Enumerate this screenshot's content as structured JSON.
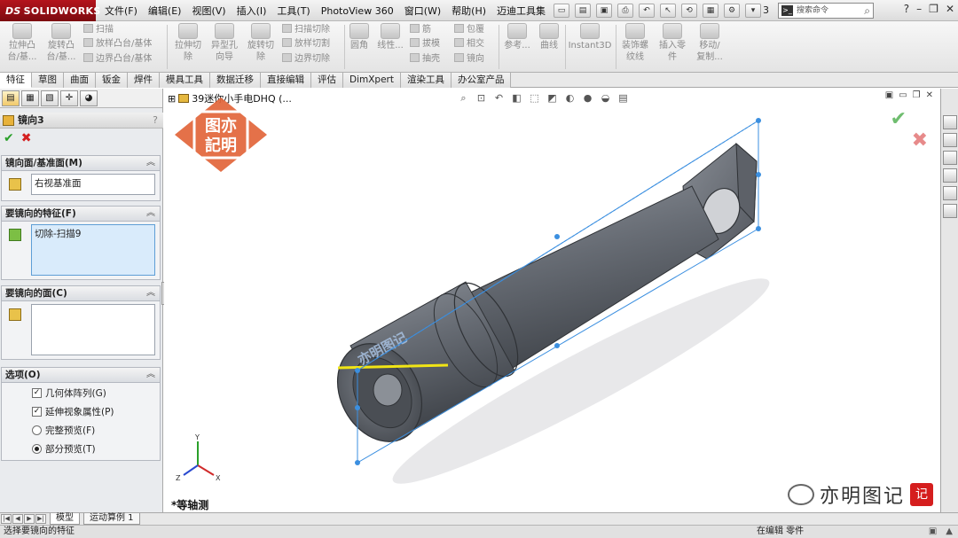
{
  "app": {
    "logo": "SOLIDWORKS",
    "logo_mark": "DS",
    "title_fragment": "3"
  },
  "menu": [
    "文件(F)",
    "编辑(E)",
    "视图(V)",
    "插入(I)",
    "工具(T)",
    "PhotoView 360",
    "窗口(W)",
    "帮助(H)",
    "迈迪工具集"
  ],
  "search": {
    "placeholder": "搜索命令"
  },
  "ribbon": {
    "extrude_boss": "拉伸凸\n台/基...",
    "revolve_boss": "旋转凸\n台/基...",
    "sweep": "扫描",
    "loft_boss": "放样凸台/基体",
    "boundary_boss": "边界凸台/基体",
    "extrude_cut": "拉伸切\n除",
    "hole_wizard": "异型孔\n向导",
    "revolve_cut": "旋转切\n除",
    "swept_cut": "扫描切除",
    "lofted_cut": "放样切割",
    "boundary_cut": "边界切除",
    "fillet": "圆角",
    "linear_pattern": "线性...",
    "rib": "筋",
    "draft": "拔模",
    "shell": "抽壳",
    "wrap": "包覆",
    "intersect": "相交",
    "mirror": "镜向",
    "reference": "参考...",
    "curves": "曲线",
    "instant3d": "Instant3D",
    "cosmetic_thread": "装饰螺\n纹线",
    "insert_part": "插入零\n件",
    "move_copy": "移动/\n复制..."
  },
  "tabs": [
    "特征",
    "草图",
    "曲面",
    "钣金",
    "焊件",
    "模具工具",
    "数据迁移",
    "直接编辑",
    "评估",
    "DimXpert",
    "渲染工具",
    "办公室产品"
  ],
  "property_manager": {
    "title": "镜向3",
    "help": "?",
    "mirror_plane": {
      "header": "镜向面/基准面(M)",
      "value": "右视基准面"
    },
    "features": {
      "header": "要镜向的特征(F)",
      "value": "切除-扫描9"
    },
    "faces": {
      "header": "要镜向的面(C)",
      "value": ""
    },
    "options": {
      "header": "选项(O)",
      "geometry_pattern": "几何体阵列(G)",
      "propagate_visual": "延伸视象属性(P)",
      "full_preview": "完整预览(F)",
      "partial_preview": "部分预览(T)"
    }
  },
  "viewport": {
    "tree_root": "39迷你小手电DHQ  (...",
    "view_name": "*等轴测",
    "watermark_text": [
      "图亦",
      "記明"
    ],
    "part_text": "亦明图记",
    "brand_name": "亦明图记",
    "brand_seal": "记",
    "axes": {
      "y": "Y",
      "x": "X",
      "z": "Z"
    }
  },
  "bottom_tabs": [
    "模型",
    "运动算例 1"
  ],
  "status": {
    "message": "选择要镜向的特征",
    "editing": "在编辑 零件"
  },
  "colors": {
    "logo_red": "#a3121a",
    "part_gray": "#6b7079",
    "highlight_blue": "#3b8fe0",
    "sketch_yellow": "#f1e515"
  }
}
